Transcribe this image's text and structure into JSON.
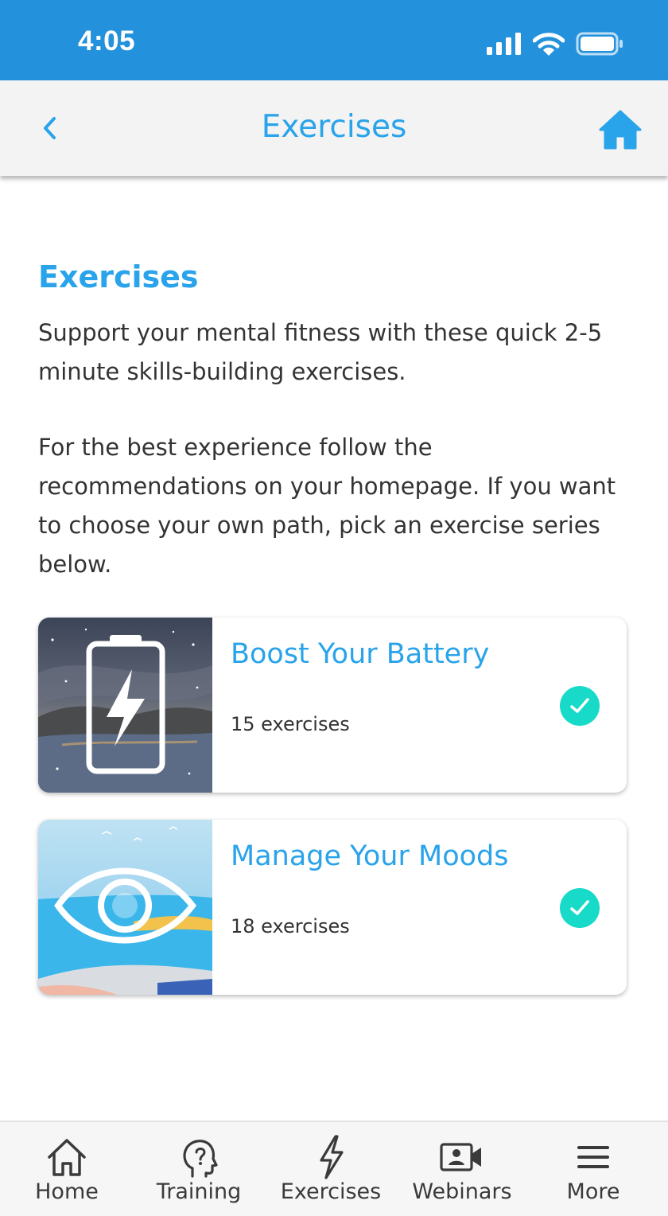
{
  "status_bar": {
    "time": "4:05"
  },
  "nav": {
    "title": "Exercises",
    "accent_color": "#29a3ea"
  },
  "main": {
    "heading": "Exercises",
    "intro": "Support your mental fitness with these quick 2-5 minute skills-building exercises.",
    "guidance": "For the best experience follow the recommendations on your homepage. If you want to choose your own path, pick an exercise series below."
  },
  "series": [
    {
      "title": "Boost Your Battery",
      "count": "15 exercises",
      "completed": true,
      "image_icon": "battery-bolt-icon"
    },
    {
      "title": "Manage Your Moods",
      "count": "18 exercises",
      "completed": true,
      "image_icon": "eye-icon"
    }
  ],
  "tab_bar": {
    "items": [
      {
        "label": "Home",
        "icon": "home-outline-icon"
      },
      {
        "label": "Training",
        "icon": "head-question-icon"
      },
      {
        "label": "Exercises",
        "icon": "lightning-icon"
      },
      {
        "label": "Webinars",
        "icon": "video-person-icon"
      },
      {
        "label": "More",
        "icon": "hamburger-menu-icon"
      }
    ]
  },
  "colors": {
    "status_bar": "#2391dc",
    "check": "#17dac9"
  }
}
